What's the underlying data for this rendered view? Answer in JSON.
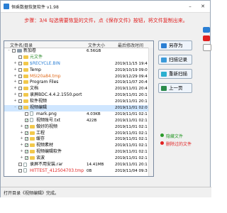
{
  "window": {
    "title": "恒乘数据恢复软件 v1.98",
    "minimize": "–",
    "close": "✕"
  },
  "hint": "步骤：3/4 勾选需要恢复的文件，点《保存文件》按钮，将文件复制出来。",
  "columns": {
    "name": "文件名/目录",
    "size": "文件大小",
    "date": "最后修改时间"
  },
  "rows": [
    {
      "expander": "–",
      "checked": false,
      "icon": "drive",
      "name": "新加卷",
      "size": "6.56GB",
      "date": "",
      "color": "#000000",
      "level": 0
    },
    {
      "expander": "",
      "checked": false,
      "icon": "folder",
      "name": "元文件",
      "size": "",
      "date": "",
      "color": "#2a8a2a",
      "level": 1
    },
    {
      "expander": "+",
      "checked": false,
      "icon": "folder",
      "name": "$RECYCLE.BIN",
      "size": "",
      "date": "2019/11/15 19:4",
      "color": "#2a7fd4",
      "level": 1
    },
    {
      "expander": "+",
      "checked": false,
      "icon": "folder",
      "name": "Temp",
      "size": "",
      "date": "2019/10/19 09:0",
      "color": "#000000",
      "level": 1
    },
    {
      "expander": "+",
      "checked": false,
      "icon": "folder",
      "name": "MSI20a84.tmp",
      "size": "",
      "date": "2019/12/29 09:4",
      "color": "#e06a1a",
      "level": 1
    },
    {
      "expander": "+",
      "checked": false,
      "icon": "folder",
      "name": "Program Files",
      "size": "",
      "date": "2019/11/07 20:4",
      "color": "#000000",
      "level": 1
    },
    {
      "expander": "+",
      "checked": false,
      "icon": "folder",
      "name": "文档",
      "size": "",
      "date": "2019/11/01 20:4",
      "color": "#000000",
      "level": 1
    },
    {
      "expander": "+",
      "checked": false,
      "icon": "folder",
      "name": "录屏BDC.4.4.2.1550.port",
      "size": "",
      "date": "2019/11/01 20:1",
      "color": "#000000",
      "level": 1
    },
    {
      "expander": "+",
      "checked": false,
      "icon": "folder",
      "name": "软件视频",
      "size": "",
      "date": "2019/11/01 20:1",
      "color": "#000000",
      "level": 1
    },
    {
      "expander": "–",
      "checked": true,
      "icon": "folder",
      "name": "视频编辑",
      "size": "",
      "date": "2019/11/01 02:0",
      "color": "#000000",
      "level": 1,
      "selected": true
    },
    {
      "expander": "",
      "checked": false,
      "icon": "file",
      "name": "mark.png",
      "size": "4.03KB",
      "date": "2019/11/01 02:1",
      "color": "#000000",
      "level": 2
    },
    {
      "expander": "",
      "checked": true,
      "icon": "file",
      "name": "视频账号.txt",
      "size": "422B",
      "date": "2019/11/01 02:1",
      "color": "#000000",
      "level": 2
    },
    {
      "expander": "+",
      "checked": true,
      "icon": "folder",
      "name": "做好的视频",
      "size": "",
      "date": "2019/11/01 02:1",
      "color": "#000000",
      "level": 2
    },
    {
      "expander": "+",
      "checked": true,
      "icon": "folder",
      "name": "工程",
      "size": "",
      "date": "2019/11/01 02:1",
      "color": "#000000",
      "level": 2
    },
    {
      "expander": "+",
      "checked": true,
      "icon": "folder",
      "name": "缓存",
      "size": "",
      "date": "2019/11/01 02:1",
      "color": "#000000",
      "level": 2
    },
    {
      "expander": "+",
      "checked": true,
      "icon": "folder",
      "name": "视频素材",
      "size": "",
      "date": "2019/11/01 02:1",
      "color": "#000000",
      "level": 2
    },
    {
      "expander": "+",
      "checked": true,
      "icon": "folder",
      "name": "视频编辑软件",
      "size": "",
      "date": "2019/11/01 02:1",
      "color": "#000000",
      "level": 2
    },
    {
      "expander": "+",
      "checked": true,
      "icon": "folder",
      "name": "谈波",
      "size": "",
      "date": "2019/11/01 02:1",
      "color": "#000000",
      "level": 2
    },
    {
      "expander": "",
      "checked": false,
      "icon": "file",
      "name": "录屏不用安装.rar",
      "size": "14.41MB",
      "date": "2019/11/01 20:1",
      "color": "#000000",
      "level": 1
    },
    {
      "expander": "",
      "checked": false,
      "icon": "file",
      "name": "HITTEST_412504703.tmp",
      "size": "0B",
      "date": "2019/11/04 09:3",
      "color": "#e02020",
      "level": 1
    }
  ],
  "buttons": [
    {
      "label": "另存为",
      "icon_color": "#2a7fd4"
    },
    {
      "label": "扫描记录",
      "icon_color": "#3a9ad9"
    },
    {
      "label": "重新扫描",
      "icon_color": "#2ab0d0"
    },
    {
      "label": "上一页",
      "icon_color": "#2a8a4a"
    }
  ],
  "legend": [
    {
      "label": "隐藏文件",
      "color": "#2a9a2a"
    },
    {
      "label": "删除过的文件",
      "color": "#e02020"
    }
  ],
  "status": "打开目录《视频编辑》完成。",
  "colors": {
    "hint": "#e02020",
    "accent": "#2a7fd4"
  }
}
